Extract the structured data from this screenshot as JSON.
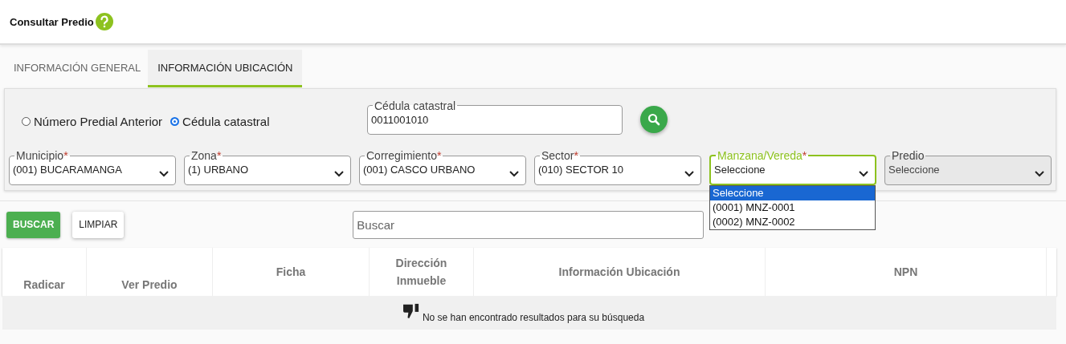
{
  "header": {
    "title": "Consultar Predio"
  },
  "tabs": [
    {
      "label": "INFORMACIÓN GENERAL",
      "selected": false
    },
    {
      "label": "INFORMACIÓN UBICACIÓN",
      "selected": true
    }
  ],
  "search_mode": [
    {
      "label": "Número Predial Anterior",
      "selected": false
    },
    {
      "label": "Cédula catastral",
      "selected": true
    }
  ],
  "cedula_field": {
    "label": "Cédula catastral",
    "value": "0011001010"
  },
  "filters": [
    {
      "label": "Municipio",
      "required_mark": "*",
      "value": "(001) BUCARAMANGA",
      "focused": false,
      "disabled": false
    },
    {
      "label": "Zona",
      "required_mark": "*",
      "value": "(1) URBANO",
      "focused": false,
      "disabled": false
    },
    {
      "label": "Corregimiento",
      "required_mark": "*",
      "value": "(001) CASCO URBANO",
      "focused": false,
      "disabled": false
    },
    {
      "label": "Sector",
      "required_mark": "*",
      "value": "(010) SECTOR 10",
      "focused": false,
      "disabled": false
    },
    {
      "label": "Manzana/Vereda",
      "required_mark": "*",
      "value": "Seleccione",
      "focused": true,
      "disabled": false,
      "options": [
        {
          "label": "Seleccione",
          "selected": true
        },
        {
          "label": "(0001) MNZ-0001",
          "selected": false
        },
        {
          "label": "(0002) MNZ-0002",
          "selected": false
        }
      ]
    },
    {
      "label": "Predio",
      "value": "Seleccione",
      "focused": false,
      "disabled": true
    }
  ],
  "buttons": [
    {
      "label": "BUSCAR",
      "kind": "primary"
    },
    {
      "label": "LIMPIAR",
      "kind": "secondary"
    }
  ],
  "table_search": {
    "placeholder": "Buscar"
  },
  "table": {
    "columns": [
      "Radicar",
      "Ver Predio",
      "Ficha",
      "Dirección Inmueble",
      "Información Ubicación",
      "NPN"
    ],
    "empty_message": "No se han encontrado resultados para su búsqueda"
  }
}
